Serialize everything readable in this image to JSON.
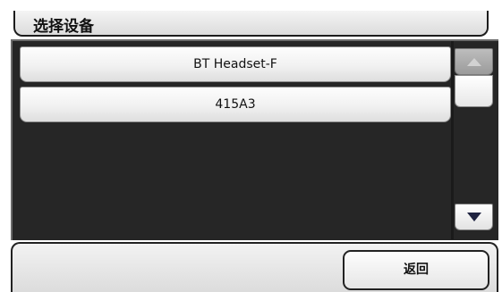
{
  "header": {
    "title": "选择设备"
  },
  "device_list": {
    "items": [
      {
        "label": "BT Headset-F"
      },
      {
        "label": "415A3"
      }
    ],
    "scroll_up_icon": "triangle-up-icon",
    "scroll_down_icon": "triangle-down-icon"
  },
  "footer": {
    "back_label": "返回"
  },
  "colors": {
    "panel_background": "#262626",
    "button_light": "#f1f1f1",
    "scroll_up_disabled": "#a8a8a8",
    "arrow_dark": "#1f2340"
  }
}
